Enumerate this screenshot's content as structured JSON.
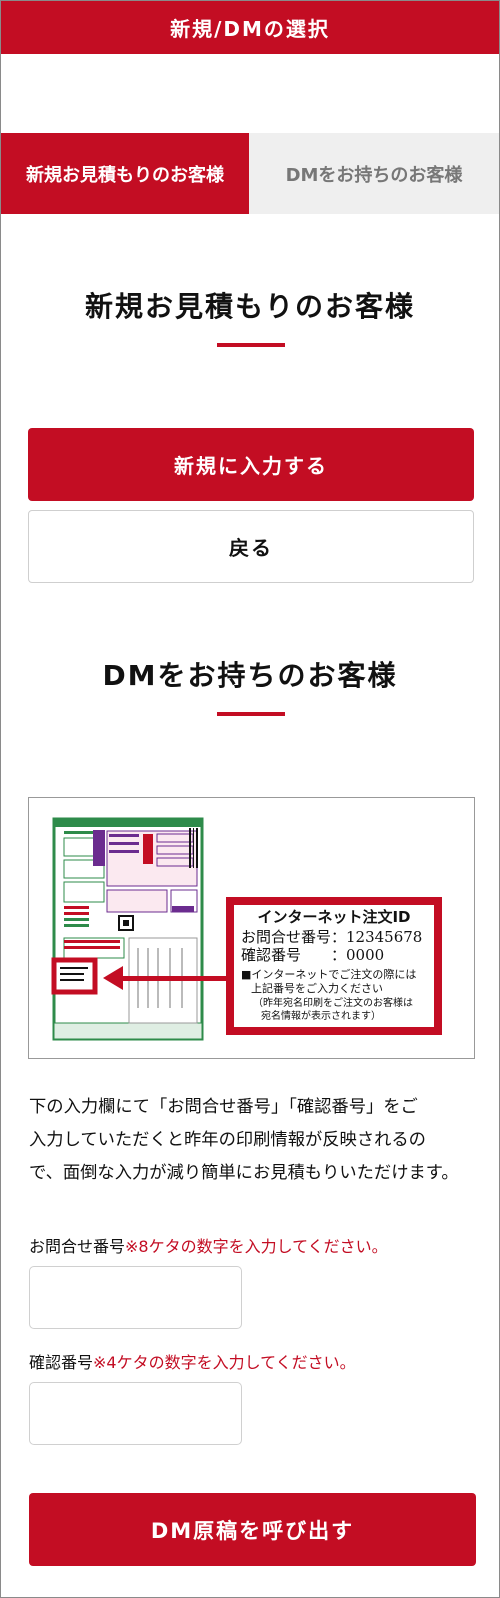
{
  "header": {
    "title": "新規/DMの選択"
  },
  "tabs": [
    {
      "label": "新規お見積もりのお客様",
      "active": true
    },
    {
      "label": "DMをお持ちのお客様",
      "active": false
    }
  ],
  "new_section": {
    "title": "新規お見積もりのお客様",
    "primary_button": "新規に入力する",
    "back_button": "戻る"
  },
  "dm_section": {
    "title": "DMをお持ちのお客様",
    "callout": {
      "title": "インターネット注文ID",
      "inquiry_line": "お問合せ番号：12345678",
      "confirm_line": "確認番号　　：0000",
      "note_1": "■インターネットでご注文の際には",
      "note_2": "上記番号をご入力ください",
      "note_3": "（昨年宛名印刷をご注文のお客様は",
      "note_4": "宛名情報が表示されます）"
    },
    "description_1": "下の入力欄にて「お問合せ番号」「確認番号」をご",
    "description_2": "入力していただくと昨年の印刷情報が反映されるの",
    "description_3": "で、面倒な入力が減り簡単にお見積もりいただけます。",
    "inquiry_label": "お問合せ番号",
    "inquiry_note": "※8ケタの数字を入力してください。",
    "inquiry_value": "",
    "confirm_label": "確認番号",
    "confirm_note": "※4ケタの数字を入力してください。",
    "confirm_value": "",
    "submit_button": "DM原稿を呼び出す"
  },
  "colors": {
    "brand_red": "#c30d23",
    "tab_inactive_bg": "#efefef",
    "form_green": "#2e8b4a",
    "form_purple": "#6b2c8f"
  }
}
